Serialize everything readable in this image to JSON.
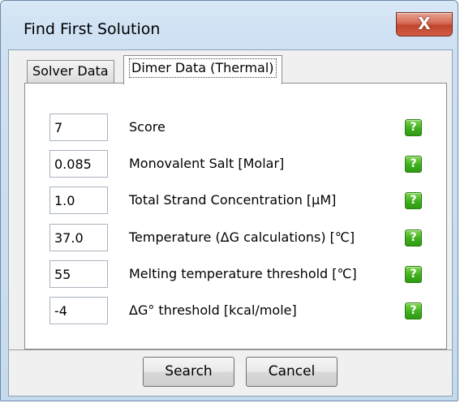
{
  "window": {
    "title": "Find First Solution",
    "close_glyph": "X"
  },
  "tabs": [
    {
      "label": "Solver Data",
      "selected": false
    },
    {
      "label": "Dimer Data (Thermal)",
      "selected": true
    }
  ],
  "rows": [
    {
      "value": "7",
      "label": "Score",
      "help": "?"
    },
    {
      "value": "0.085",
      "label": "Monovalent Salt [Molar]",
      "help": "?"
    },
    {
      "value": "1.0",
      "label": "Total Strand Concentration [μM]",
      "help": "?"
    },
    {
      "value": "37.0",
      "label": "Temperature (ΔG calculations) [℃]",
      "help": "?"
    },
    {
      "value": "55",
      "label": "Melting temperature threshold [℃]",
      "help": "?"
    },
    {
      "value": "-4",
      "label": "ΔG° threshold [kcal/mole]",
      "help": "?"
    }
  ],
  "buttons": {
    "search": "Search",
    "cancel": "Cancel"
  },
  "icons": {
    "close": "close-icon",
    "help": "help-icon"
  },
  "colors": {
    "help_green": "#3fae1e",
    "close_red": "#c0452e",
    "title_bar": "#cfe1f3"
  }
}
